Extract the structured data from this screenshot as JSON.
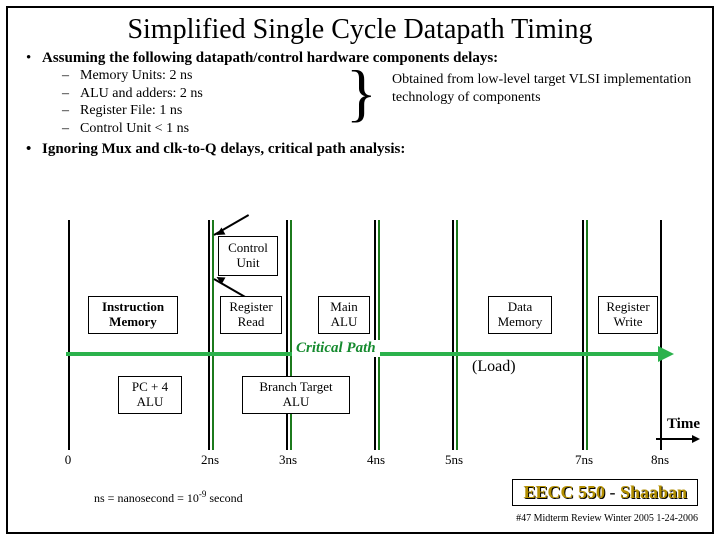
{
  "title": "Simplified Single Cycle Datapath Timing",
  "assumption_line": "Assuming the following datapath/control hardware components delays:",
  "delays": [
    "Memory Units: 2 ns",
    "ALU and adders: 2 ns",
    "Register File: 1 ns",
    "Control Unit < 1 ns"
  ],
  "brace_note": "Obtained from low-level target VLSI implementation technology of components",
  "ignore_line": "Ignoring Mux and clk-to-Q delays, critical path analysis:",
  "boxes": {
    "control_unit": "Control Unit",
    "instruction_memory": "Instruction Memory",
    "register_read": "Register Read",
    "main_alu": "Main ALU",
    "data_memory": "Data Memory",
    "register_write": "Register Write",
    "pc4_alu": "PC + 4 ALU",
    "branch_target": "Branch Target ALU"
  },
  "critical_path_label": "Critical Path",
  "load_label": "(Load)",
  "time_label": "Time",
  "axis": {
    "t0": "0",
    "t2": "2ns",
    "t3": "3ns",
    "t4": "4ns",
    "t5": "5ns",
    "t7": "7ns",
    "t8": "8ns"
  },
  "footnote_prefix": "ns = nanosecond = 10",
  "footnote_exp": "-9",
  "footnote_suffix": " second",
  "course": {
    "code": "EECC 550",
    "sep": " - ",
    "author": "Shaaban"
  },
  "page_meta": "#47  Midterm Review  Winter 2005 1-24-2006",
  "chart_data": {
    "type": "timeline",
    "title": "Single Cycle Datapath Timing (Load critical path)",
    "xlabel": "Time (ns)",
    "xlim": [
      0,
      8
    ],
    "ticks": [
      0,
      2,
      3,
      4,
      5,
      7,
      8
    ],
    "stages": [
      {
        "name": "Instruction Memory",
        "start": 0,
        "end": 2
      },
      {
        "name": "Control Unit",
        "start": 2,
        "end": 3,
        "parallel": true
      },
      {
        "name": "Register Read",
        "start": 2,
        "end": 3
      },
      {
        "name": "Main ALU",
        "start": 3,
        "end": 5
      },
      {
        "name": "Data Memory",
        "start": 5,
        "end": 7
      },
      {
        "name": "Register Write",
        "start": 7,
        "end": 8
      },
      {
        "name": "PC + 4 ALU",
        "start": 0,
        "end": 2,
        "parallel": true
      },
      {
        "name": "Branch Target ALU",
        "start": 2,
        "end": 4,
        "parallel": true
      }
    ],
    "critical_path": [
      "Instruction Memory",
      "Register Read",
      "Main ALU",
      "Data Memory",
      "Register Write"
    ],
    "critical_path_ns": 8,
    "critical_instruction": "Load"
  }
}
